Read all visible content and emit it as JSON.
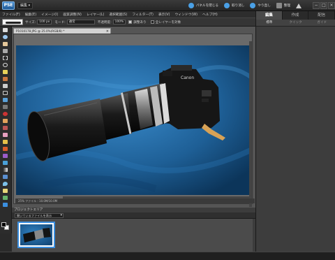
{
  "app": {
    "logo": "PSE",
    "mode_label": "編集 ▾"
  },
  "title_actions": [
    {
      "label": "パネルを閉じる",
      "icon": "refresh-icon"
    },
    {
      "label": "取り消し",
      "icon": "undo-icon"
    },
    {
      "label": "やり直し",
      "icon": "redo-icon"
    },
    {
      "label": "整理",
      "icon": "organizer-icon"
    },
    {
      "label": "",
      "icon": "home-icon"
    }
  ],
  "window_buttons": [
    "−",
    "□",
    "×"
  ],
  "menu": [
    "ファイル(F)",
    "編集(E)",
    "イメージ(I)",
    "画質調整(N)",
    "レイヤー(L)",
    "選択範囲(S)",
    "フィルター(T)",
    "表示(V)",
    "ウィンドウ(W)",
    "ヘルプ(H)"
  ],
  "options": {
    "size_label": "サイズ:",
    "size_value": "100 px",
    "mode_label": "モード:",
    "mode_value": "通常",
    "opacity_label": "不透明度:",
    "opacity_value": "100%",
    "aligned_label": "調整あり",
    "sample_all_label": "全レイヤーを対象"
  },
  "document": {
    "tab_title": "P1010178.JPG @ 25.0%(RGB/8) *",
    "status": "25%   ファイル : 10.0M/10.0M"
  },
  "project_bin": {
    "title": "プロジェクトエリア",
    "dropdown": "開いているファイルを表示"
  },
  "right_panel": {
    "tabs": [
      "編集",
      "作成",
      "配信"
    ],
    "active_tab": 0,
    "subtabs": [
      "標準",
      "クイック",
      "ガイド"
    ],
    "active_subtab": 0
  },
  "tools": [
    "move",
    "zoom",
    "hand",
    "eyedropper",
    "marquee",
    "lasso",
    "magic-wand",
    "selection-brush",
    "type",
    "crop",
    "cookie-cutter",
    "straighten",
    "red-eye",
    "spot-healing",
    "clone-stamp",
    "eraser",
    "pencil",
    "brush",
    "smart-brush",
    "paint-bucket",
    "gradient",
    "shape",
    "blur",
    "sponge",
    "custom-shape",
    "detail-smart-brush",
    "recompose"
  ],
  "colors": {
    "accent": "#3b8fe0",
    "background": "#2a2a2a",
    "photo_bg": "#1d5f97"
  }
}
